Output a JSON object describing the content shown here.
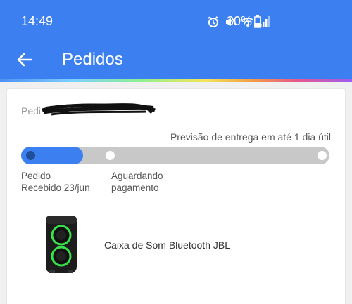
{
  "status_bar": {
    "time": "14:49",
    "battery": "30%"
  },
  "header": {
    "title": "Pedidos"
  },
  "order": {
    "label": "Pedi"
  },
  "delivery": {
    "forecast": "Previsão de entrega em até 1 dia útil",
    "progress": 0.2
  },
  "steps": [
    {
      "line1": "Pedido",
      "line2": "Recebido 23/jun",
      "state": "done"
    },
    {
      "line1": "Aguardando",
      "line2": "pagamento",
      "state": "pending"
    },
    {
      "line1": "",
      "line2": "",
      "state": "pending"
    }
  ],
  "product": {
    "name": "Caixa de Som Bluetooth JBL"
  },
  "colors": {
    "primary": "#3b7ff0",
    "active_dot": "#1e4f9a",
    "track": "#c8c8c8"
  },
  "icons": [
    "alarm-icon",
    "vibrate-mute-icon",
    "wifi-icon",
    "signal-icon",
    "battery-icon",
    "back-arrow-icon"
  ]
}
